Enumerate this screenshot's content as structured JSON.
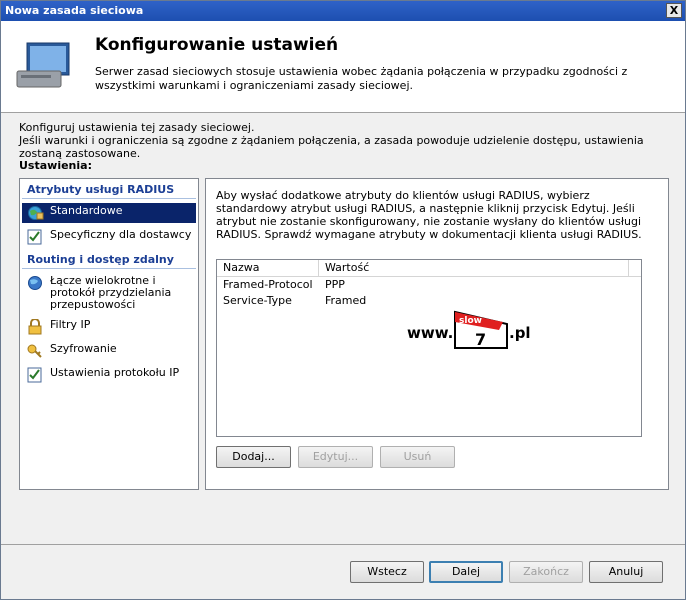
{
  "window": {
    "title": "Nowa zasada sieciowa",
    "close_label": "X"
  },
  "header": {
    "title": "Konfigurowanie ustawień",
    "description": "Serwer zasad sieciowych stosuje ustawienia wobec żądania połączenia w przypadku zgodności z wszystkimi warunkami i ograniczeniami zasady sieciowej."
  },
  "intro": {
    "line1": "Konfiguruj ustawienia tej zasady sieciowej.",
    "line2": "Jeśli warunki i ograniczenia są zgodne z żądaniem połączenia, a zasada powoduje udzielenie dostępu, ustawienia zostaną zastosowane."
  },
  "settings_label": "Ustawienia:",
  "nav": {
    "group1": "Atrybuty usługi RADIUS",
    "group1_items": [
      {
        "label": "Standardowe",
        "icon": "globe-icon",
        "selected": true
      },
      {
        "label": "Specyficzny dla dostawcy",
        "icon": "checklist-icon",
        "selected": false
      }
    ],
    "group2": "Routing i dostęp zdalny",
    "group2_items": [
      {
        "label": "Łącze wielokrotne i protokół przydzielania przepustowości",
        "icon": "globe-icon"
      },
      {
        "label": "Filtry IP",
        "icon": "lock-icon"
      },
      {
        "label": "Szyfrowanie",
        "icon": "key-icon"
      },
      {
        "label": "Ustawienia protokołu IP",
        "icon": "checklist-icon"
      }
    ]
  },
  "details": {
    "description": "Aby wysłać dodatkowe atrybuty do klientów usługi RADIUS, wybierz standardowy atrybut usługi RADIUS, a następnie kliknij przycisk Edytuj. Jeśli atrybut nie zostanie skonfigurowany, nie zostanie wysłany do klientów usługi RADIUS. Sprawdź wymagane atrybuty w dokumentacji klienta usługi RADIUS.",
    "columns": {
      "name": "Nazwa",
      "value": "Wartość"
    },
    "rows": [
      {
        "name": "Framed-Protocol",
        "value": "PPP"
      },
      {
        "name": "Service-Type",
        "value": "Framed"
      }
    ],
    "buttons": {
      "add": "Dodaj...",
      "edit": "Edytuj...",
      "remove": "Usuń"
    }
  },
  "watermark": {
    "prefix": "www.",
    "top": "slow",
    "number": "7",
    "suffix": ".pl"
  },
  "footer": {
    "back": "Wstecz",
    "next": "Dalej",
    "finish": "Zakończ",
    "cancel": "Anuluj"
  }
}
